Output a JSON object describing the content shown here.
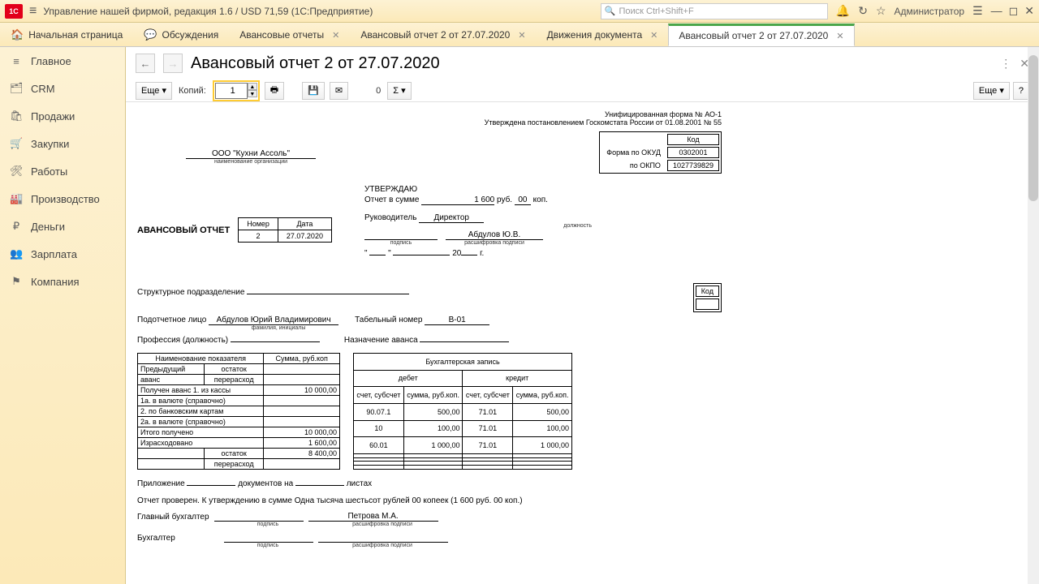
{
  "titlebar": {
    "app_title": "Управление нашей фирмой, редакция 1.6 / USD 71,59  (1С:Предприятие)",
    "search_placeholder": "Поиск Ctrl+Shift+F",
    "user": "Администратор"
  },
  "tabs": [
    {
      "label": "Начальная страница",
      "icon": "🏠",
      "closable": false
    },
    {
      "label": "Обсуждения",
      "icon": "💬",
      "closable": false
    },
    {
      "label": "Авансовые отчеты",
      "closable": true
    },
    {
      "label": "Авансовый отчет 2 от 27.07.2020",
      "closable": true
    },
    {
      "label": "Движения документа",
      "closable": true
    },
    {
      "label": "Авансовый отчет 2 от 27.07.2020",
      "closable": true,
      "active": true
    }
  ],
  "sidebar": [
    {
      "icon": "≡",
      "label": "Главное"
    },
    {
      "icon": "🗂",
      "label": "CRM"
    },
    {
      "icon": "🛍",
      "label": "Продажи"
    },
    {
      "icon": "🛒",
      "label": "Закупки"
    },
    {
      "icon": "🛠",
      "label": "Работы"
    },
    {
      "icon": "🏭",
      "label": "Производство"
    },
    {
      "icon": "₽",
      "label": "Деньги"
    },
    {
      "icon": "👥",
      "label": "Зарплата"
    },
    {
      "icon": "⚑",
      "label": "Компания"
    }
  ],
  "page": {
    "title": "Авансовый отчет 2 от 27.07.2020"
  },
  "toolbar": {
    "more": "Еще ▾",
    "copies_label": "Копий:",
    "copies_value": "1",
    "zero": "0",
    "sigma": "Σ ▾",
    "help": "?"
  },
  "doc": {
    "form_header_l1": "Унифицированная форма № АО-1",
    "form_header_l2": "Утверждена постановлением Госкомстата России от  01.08.2001 № 55",
    "org_name": "ООО \"Кухни Ассоль\"",
    "org_caption": "наименование организации",
    "code_labels": {
      "kod": "Код",
      "okud": "Форма по ОКУД",
      "okpo": "по ОКПО"
    },
    "okud": "0302001",
    "okpo": "1027739829",
    "approve": "УТВЕРЖДАЮ",
    "sum_label": "Отчет в сумме",
    "sum_value": "1 600",
    "rub": "руб.",
    "kop_val": "00",
    "kop": "коп.",
    "head_label": "Руководитель",
    "head_pos": "Директор",
    "pos_caption": "должность",
    "head_name": "Абдулов Ю.В.",
    "sig_caption": "подпись",
    "decode_caption": "расшифровка подписи",
    "date_year": "20",
    "date_g": "г.",
    "av_title": "АВАНСОВЫЙ ОТЧЕТ",
    "th_number": "Номер",
    "th_date": "Дата",
    "number": "2",
    "date": "27.07.2020",
    "struct_label": "Структурное подразделение",
    "kod2": "Код",
    "person_label": "Подотчетное лицо",
    "person_name": "Абдулов Юрий Владимирович",
    "fio_caption": "фамилия, инициалы",
    "tab_label": "Табельный номер",
    "tab_num": "В-01",
    "prof_label": "Профессия (должность)",
    "purpose_label": "Назначение аванса",
    "left_table": {
      "h1": "Наименование показателя",
      "h2": "Сумма, руб.коп",
      "rows": [
        {
          "c1": "Предыдущий",
          "c2": "остаток",
          "c3": ""
        },
        {
          "c1": "аванс",
          "c2": "перерасход",
          "c3": ""
        },
        {
          "c1": "Получен аванс 1. из кассы",
          "c2": "",
          "c3": "10 000,00"
        },
        {
          "c1": "1а. в валюте (справочно)",
          "c2": "",
          "c3": ""
        },
        {
          "c1": "2. по банковским картам",
          "c2": "",
          "c3": ""
        },
        {
          "c1": "2а. в валюте (справочно)",
          "c2": "",
          "c3": ""
        },
        {
          "c1": "Итого получено",
          "c2": "",
          "c3": "10 000,00"
        },
        {
          "c1": "Израсходовано",
          "c2": "",
          "c3": "1 600,00"
        },
        {
          "c1": "",
          "c2": "остаток",
          "c3": "8 400,00"
        },
        {
          "c1": "",
          "c2": "перерасход",
          "c3": ""
        }
      ]
    },
    "right_table": {
      "title": "Бухгалтерская запись",
      "h_debet": "дебет",
      "h_kredit": "кредит",
      "sub_acc": "счет, субсчет",
      "sub_sum": "сумма, руб.коп.",
      "rows": [
        {
          "da": "90.07.1",
          "ds": "500,00",
          "ka": "71.01",
          "ks": "500,00"
        },
        {
          "da": "10",
          "ds": "100,00",
          "ka": "71.01",
          "ks": "100,00"
        },
        {
          "da": "60.01",
          "ds": "1 000,00",
          "ka": "71.01",
          "ks": "1 000,00"
        },
        {
          "da": "",
          "ds": "",
          "ka": "",
          "ks": ""
        },
        {
          "da": "",
          "ds": "",
          "ka": "",
          "ks": ""
        },
        {
          "da": "",
          "ds": "",
          "ka": "",
          "ks": ""
        },
        {
          "da": "",
          "ds": "",
          "ka": "",
          "ks": ""
        }
      ]
    },
    "attach_l1": "Приложение",
    "attach_l2": "документов на",
    "attach_l3": "листах",
    "checked": "Отчет проверен. К утверждению в сумме Одна тысяча шестьсот рублей 00 копеек (1 600 руб. 00 коп.)",
    "chief_acc": "Главный бухгалтер",
    "chief_name": "Петрова М.А.",
    "acc": "Бухгалтер"
  }
}
